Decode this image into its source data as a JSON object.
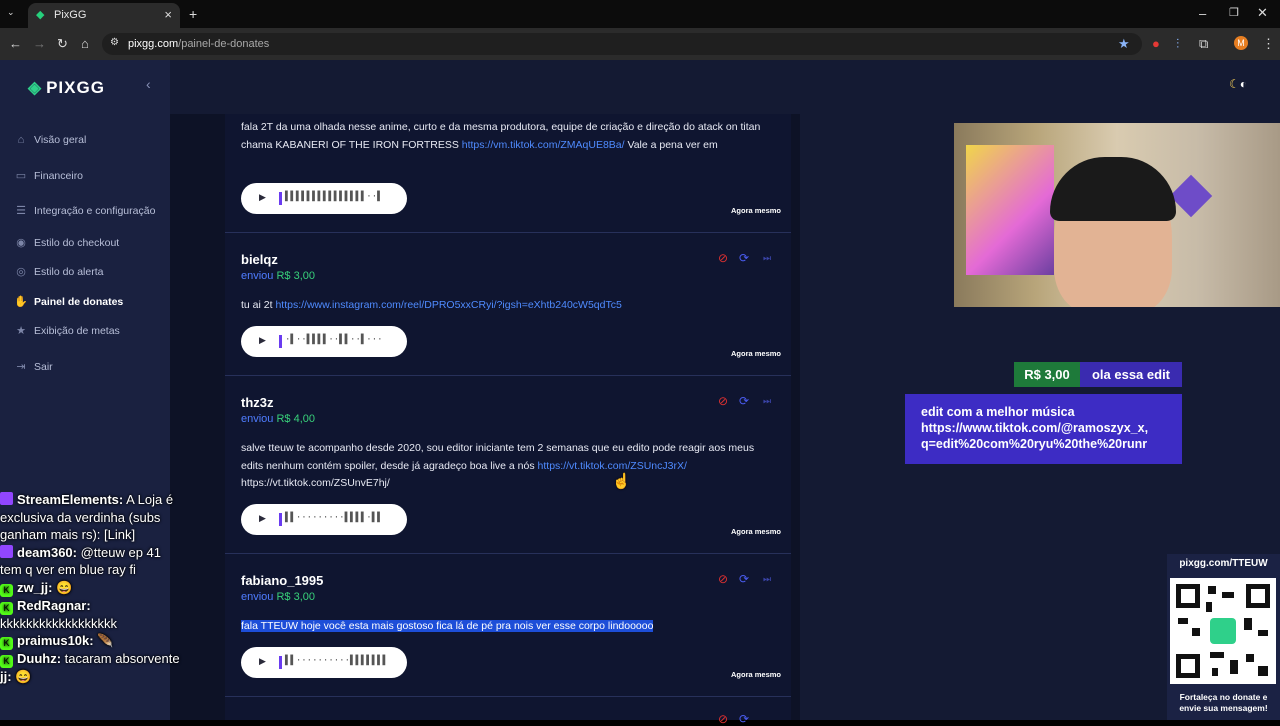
{
  "browser": {
    "tab_title": "PixGG",
    "url_host": "pixgg.com",
    "url_path": "/painel-de-donates",
    "profile_initial": "M"
  },
  "sidebar": {
    "brand": "PIXGG",
    "items": [
      {
        "label": "Visão geral",
        "icon": "home-icon"
      },
      {
        "label": "Financeiro",
        "icon": "wallet-icon"
      },
      {
        "label": "Integração e configuração",
        "icon": "settings-icon"
      },
      {
        "label": "Estilo do checkout",
        "icon": "palette-icon"
      },
      {
        "label": "Estilo do alerta",
        "icon": "bell-icon"
      },
      {
        "label": "Painel de donates",
        "icon": "donate-icon"
      },
      {
        "label": "Exibição de metas",
        "icon": "star-icon"
      },
      {
        "label": "Sair",
        "icon": "logout-icon"
      }
    ],
    "active_index": 5
  },
  "donations": [
    {
      "message_parts": [
        "fala 2T da uma olhada nesse anime, curto e da mesma produtora, equipe de criação e direção do atack on titan chama KABANERI OF THE IRON FORTRESS ",
        "https://vm.tiktok.com/ZMAqUE8Ba/",
        " Vale a pena ver em"
      ],
      "waveform": "▌▌▌▌▌▌▌▌▌▌▌▌▌▌▌··▌",
      "time": "Agora mesmo"
    },
    {
      "donor": "bielqz",
      "sent_label": "enviou",
      "amount": "R$ 3,00",
      "message_parts": [
        "tu ai 2t ",
        "https://www.instagram.com/reel/DPRO5xxCRyi/?igsh=eXhtb240cW5qdTc5",
        ""
      ],
      "waveform": "·▌··▌▌▌▌··▌▌··▌···",
      "time": "Agora mesmo"
    },
    {
      "donor": "thz3z",
      "sent_label": "enviou",
      "amount": "R$ 4,00",
      "message_parts": [
        "salve tteuw te acompanho desde 2020, sou editor iniciante tem 2 semanas que eu edito pode reagir aos meus edits nenhum contém spoiler, desde já agradeço boa live a nós ",
        "https://vt.tiktok.com/ZSUncJ3rX/",
        " https://vt.tiktok.com/ZSUnvE7hj/"
      ],
      "waveform": "▌▌·········▌▌▌▌·▌▌",
      "time": "Agora mesmo"
    },
    {
      "donor": "fabiano_1995",
      "sent_label": "enviou",
      "amount": "R$ 3,00",
      "message_highlight": "fala TTEUW hoje você esta mais gostoso fica lá de pé pra nois ver esse corpo lindooooo",
      "waveform": "▌▌··········▌▌▌▌▌▌▌",
      "time": "Agora mesmo"
    }
  ],
  "chat": [
    {
      "platform": "twitch",
      "user": "StreamElements:",
      "text": " A Loja é exclusiva da verdinha (subs ganham mais rs): [Link]"
    },
    {
      "platform": "twitch",
      "user": "deam360:",
      "text": " @tteuw ep 41 tem q ver em blue ray fi"
    },
    {
      "platform": "kick",
      "user": "zw_jj:",
      "text": " 😄"
    },
    {
      "platform": "kick",
      "user": "RedRagnar:",
      "text": " kkkkkkkkkkkkkkkkkk"
    },
    {
      "platform": "kick",
      "user": "praimus10k:",
      "text": " 🪶"
    },
    {
      "platform": "kick",
      "user": "Duuhz:",
      "text": " tacaram absorvente"
    },
    {
      "platform": "none",
      "user": "jj:",
      "text": " 😄"
    }
  ],
  "alert": {
    "amount": "R$ 3,00",
    "title": "ola essa edit",
    "lines": [
      "edit com a melhor música",
      "https://www.tiktok.com/@ramoszyx_x,",
      "q=edit%20com%20ryu%20the%20runr"
    ]
  },
  "qr": {
    "url": "pixgg.com/TTEUW",
    "caption_line1": "Fortaleça no donate e",
    "caption_line2": "envie sua mensagem!"
  },
  "colors": {
    "sidebar_bg": "#1a2140",
    "accent_green": "#38d17a",
    "link_blue": "#4f8bff",
    "alert_purple": "#3d2cc4"
  }
}
